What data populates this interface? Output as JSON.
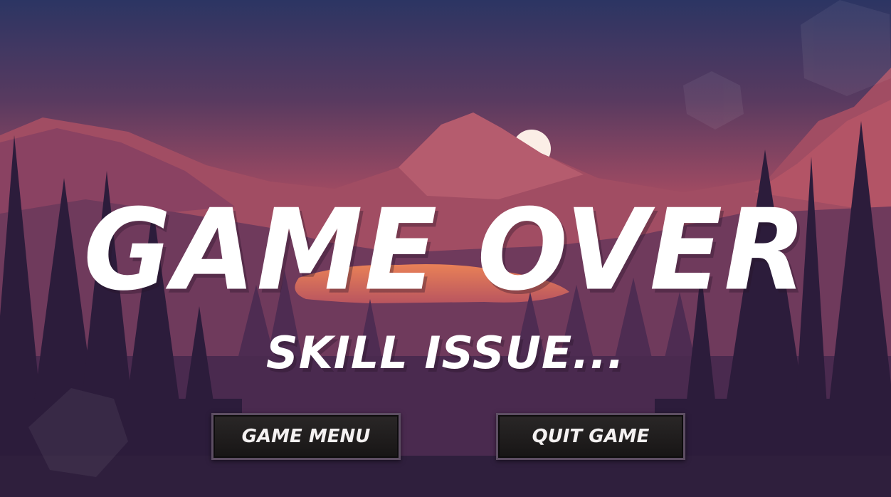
{
  "screen": {
    "title": "GAME OVER",
    "subtitle": "SKILL ISSUE..."
  },
  "buttons": {
    "game_menu": "GAME MENU",
    "quit_game": "QUIT GAME"
  },
  "colors": {
    "sky_top": "#2c3563",
    "sky_mid": "#b8566a",
    "horizon": "#e6804f",
    "sun": "#fbeee6",
    "trees_dark": "#2c1c3b",
    "button_bg": "#1d1a1a",
    "button_border": "#5d4e63"
  }
}
